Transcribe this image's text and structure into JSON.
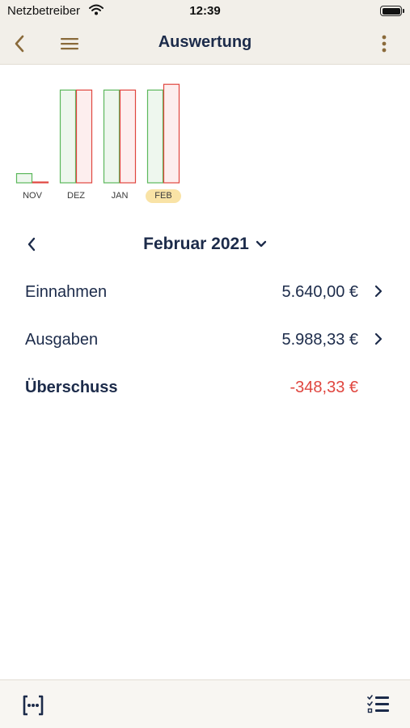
{
  "status_bar": {
    "carrier": "Netzbetreiber",
    "time": "12:39"
  },
  "nav": {
    "title": "Auswertung"
  },
  "colors": {
    "income": "#5cb85c",
    "expense": "#e0463f",
    "accent": "#8a6a3a",
    "highlight": "#f9e3a6",
    "text": "#1c2b4a"
  },
  "chart_data": {
    "type": "bar",
    "categories": [
      "NOV",
      "DEZ",
      "JAN",
      "FEB"
    ],
    "selected_index": 3,
    "series": [
      {
        "values": [
          560,
          5640,
          5640,
          5640
        ]
      },
      {
        "values": [
          40,
          5640,
          5640,
          5988.33
        ]
      }
    ],
    "ylim": [
      0,
      6000
    ]
  },
  "period": {
    "label": "Februar 2021"
  },
  "summary": {
    "income": {
      "label": "Einnahmen",
      "value": "5.640,00 €"
    },
    "expenses": {
      "label": "Ausgaben",
      "value": "5.988,33 €"
    },
    "surplus": {
      "label": "Überschuss",
      "value": "-348,33 €"
    }
  },
  "icons": {
    "back": "chevron-left-icon",
    "menu": "hamburger-icon",
    "more": "more-vertical-icon",
    "bottom_left": "bracket-dots-icon",
    "bottom_right": "checklist-icon"
  }
}
